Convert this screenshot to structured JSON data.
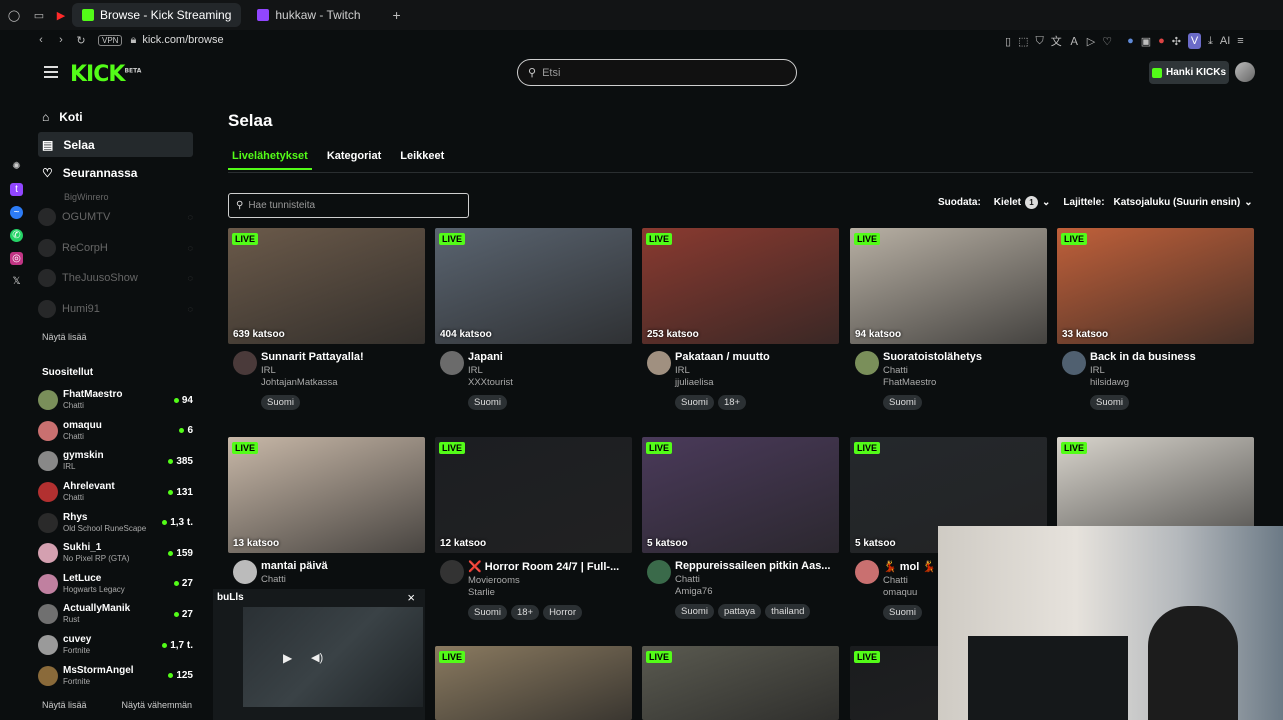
{
  "browser": {
    "tabs": [
      {
        "label": "Browse - Kick Streaming",
        "active": true,
        "color": "#53fc18"
      },
      {
        "label": "hukkaw - Twitch",
        "active": false,
        "color": "#9146ff"
      }
    ],
    "new_tab": "+",
    "vpn": "VPN",
    "url": "kick.com/browse",
    "ai_label": "AI"
  },
  "header": {
    "logo": "KICK",
    "logo_beta": "BETA",
    "search_placeholder": "Etsi",
    "kicks_button": "Hanki KICKs"
  },
  "sidebar": {
    "nav": [
      {
        "label": "Koti",
        "icon": "home-icon",
        "active": false
      },
      {
        "label": "Selaa",
        "icon": "browse-icon",
        "active": true
      },
      {
        "label": "Seurannassa",
        "icon": "heart-icon",
        "active": false
      }
    ],
    "followed": [
      "BigWinrero",
      "OGUMTV",
      "ReCorpH",
      "TheJuusoShow",
      "Humi91"
    ],
    "followed_show_more": "Näytä lisää",
    "recommended_title": "Suositellut",
    "recommended": [
      {
        "name": "FhatMaestro",
        "category": "Chatti",
        "viewers": "94",
        "color": "#7a8f5a"
      },
      {
        "name": "omaquu",
        "category": "Chatti",
        "viewers": "6",
        "color": "#c97070"
      },
      {
        "name": "gymskin",
        "category": "IRL",
        "viewers": "385",
        "color": "#888888"
      },
      {
        "name": "Ahrelevant",
        "category": "Chatti",
        "viewers": "131",
        "color": "#b23030"
      },
      {
        "name": "Rhys",
        "category": "Old School RuneScape",
        "viewers": "1,3 t.",
        "color": "#2a2a2a"
      },
      {
        "name": "Sukhi_1",
        "category": "No Pixel RP (GTA)",
        "viewers": "159",
        "color": "#d4a0b0"
      },
      {
        "name": "LetLuce",
        "category": "Hogwarts Legacy",
        "viewers": "27",
        "color": "#c080a0"
      },
      {
        "name": "ActuallyManik",
        "category": "Rust",
        "viewers": "27",
        "color": "#707070"
      },
      {
        "name": "cuvey",
        "category": "Fortnite",
        "viewers": "1,7 t.",
        "color": "#9a9a9a"
      },
      {
        "name": "MsStormAngel",
        "category": "Fortnite",
        "viewers": "125",
        "color": "#8a6a3a"
      }
    ],
    "show_more": "Näytä lisää",
    "show_less": "Näytä vähemmän"
  },
  "main": {
    "title": "Selaa",
    "tabs": [
      "Livelähetykset",
      "Kategoriat",
      "Leikkeet"
    ],
    "tag_search_placeholder": "Hae tunnisteita",
    "filter_label": "Suodata:",
    "languages_label": "Kielet",
    "languages_count": "1",
    "sort_label": "Lajittele:",
    "sort_value": "Katsojaluku (Suurin ensin)",
    "live_badge": "LIVE",
    "streams": [
      {
        "viewers": "639 katsoo",
        "title": "Sunnarit Pattayalla!",
        "category": "IRL",
        "channel": "JohtajanMatkassa",
        "tags": [
          "Suomi"
        ],
        "thumb": "#6b5a4a",
        "avatar": "#4a3a3a"
      },
      {
        "viewers": "404 katsoo",
        "title": "Japani",
        "category": "IRL",
        "channel": "XXXtourist",
        "tags": [
          "Suomi"
        ],
        "thumb": "#5a6470",
        "avatar": "#6b6b6b"
      },
      {
        "viewers": "253 katsoo",
        "title": "Pakataan / muutto",
        "category": "IRL",
        "channel": "jjuliaelisa",
        "tags": [
          "Suomi",
          "18+"
        ],
        "thumb": "#8a3a30",
        "avatar": "#a09080"
      },
      {
        "viewers": "94 katsoo",
        "title": "Suoratoistolähetys",
        "category": "Chatti",
        "channel": "FhatMaestro",
        "tags": [
          "Suomi"
        ],
        "thumb": "#b8b0a4",
        "avatar": "#7a8f5a"
      },
      {
        "viewers": "33 katsoo",
        "title": "Back in da business",
        "category": "IRL",
        "channel": "hilsidawg",
        "tags": [
          "Suomi"
        ],
        "thumb": "#c0603a",
        "avatar": "#506070"
      },
      {
        "viewers": "13 katsoo",
        "title": "mantai päivä",
        "category": "Chatti",
        "channel": "",
        "tags": [],
        "thumb": "#c8b8a8",
        "avatar": "#bbbbbb"
      },
      {
        "viewers": "12 katsoo",
        "title": "❌ Horror Room 24/7 | Full-...",
        "category": "Movierooms",
        "channel": "Starlie",
        "tags": [
          "Suomi",
          "18+",
          "Horror"
        ],
        "thumb": "#1c1e22",
        "avatar": "#333333"
      },
      {
        "viewers": "5 katsoo",
        "title": "Reppureissaileen pitkin Aas...",
        "category": "Chatti",
        "channel": "Amiga76",
        "tags": [
          "Suomi",
          "pattaya",
          "thailand"
        ],
        "thumb": "#4a3a5a",
        "avatar": "#3a6a4a"
      },
      {
        "viewers": "5 katsoo",
        "title": "💃 mol 💃",
        "category": "Chatti",
        "channel": "omaquu",
        "tags": [
          "Suomi"
        ],
        "thumb": "#24282c",
        "avatar": "#c97070"
      },
      {
        "viewers": "",
        "title": "",
        "category": "",
        "channel": "",
        "tags": [],
        "thumb": "#d8d4cc",
        "avatar": "#999999"
      }
    ],
    "third_row_thumbs": [
      "#8a7a60",
      "#5a5a50",
      "#1a1c1e"
    ]
  },
  "mini_player": {
    "channel": "buLls"
  }
}
